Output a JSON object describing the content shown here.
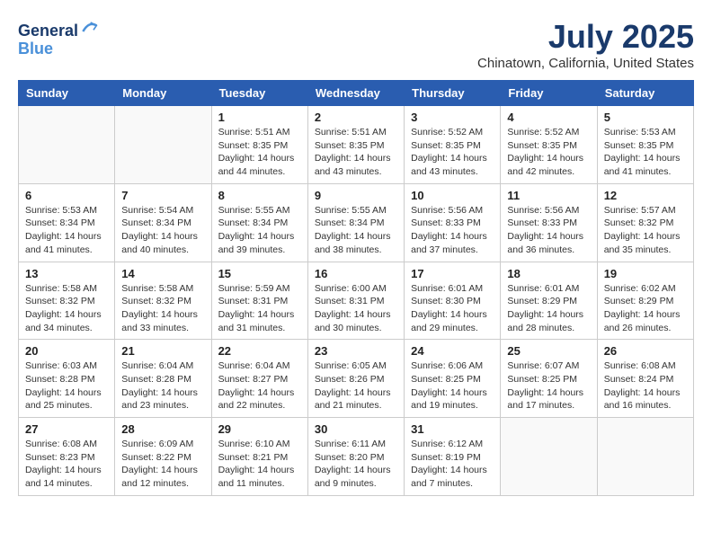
{
  "header": {
    "logo_line1": "General",
    "logo_line2": "Blue",
    "month_title": "July 2025",
    "location": "Chinatown, California, United States"
  },
  "weekdays": [
    "Sunday",
    "Monday",
    "Tuesday",
    "Wednesday",
    "Thursday",
    "Friday",
    "Saturday"
  ],
  "weeks": [
    [
      {
        "day": "",
        "info": ""
      },
      {
        "day": "",
        "info": ""
      },
      {
        "day": "1",
        "info": "Sunrise: 5:51 AM\nSunset: 8:35 PM\nDaylight: 14 hours and 44 minutes."
      },
      {
        "day": "2",
        "info": "Sunrise: 5:51 AM\nSunset: 8:35 PM\nDaylight: 14 hours and 43 minutes."
      },
      {
        "day": "3",
        "info": "Sunrise: 5:52 AM\nSunset: 8:35 PM\nDaylight: 14 hours and 43 minutes."
      },
      {
        "day": "4",
        "info": "Sunrise: 5:52 AM\nSunset: 8:35 PM\nDaylight: 14 hours and 42 minutes."
      },
      {
        "day": "5",
        "info": "Sunrise: 5:53 AM\nSunset: 8:35 PM\nDaylight: 14 hours and 41 minutes."
      }
    ],
    [
      {
        "day": "6",
        "info": "Sunrise: 5:53 AM\nSunset: 8:34 PM\nDaylight: 14 hours and 41 minutes."
      },
      {
        "day": "7",
        "info": "Sunrise: 5:54 AM\nSunset: 8:34 PM\nDaylight: 14 hours and 40 minutes."
      },
      {
        "day": "8",
        "info": "Sunrise: 5:55 AM\nSunset: 8:34 PM\nDaylight: 14 hours and 39 minutes."
      },
      {
        "day": "9",
        "info": "Sunrise: 5:55 AM\nSunset: 8:34 PM\nDaylight: 14 hours and 38 minutes."
      },
      {
        "day": "10",
        "info": "Sunrise: 5:56 AM\nSunset: 8:33 PM\nDaylight: 14 hours and 37 minutes."
      },
      {
        "day": "11",
        "info": "Sunrise: 5:56 AM\nSunset: 8:33 PM\nDaylight: 14 hours and 36 minutes."
      },
      {
        "day": "12",
        "info": "Sunrise: 5:57 AM\nSunset: 8:32 PM\nDaylight: 14 hours and 35 minutes."
      }
    ],
    [
      {
        "day": "13",
        "info": "Sunrise: 5:58 AM\nSunset: 8:32 PM\nDaylight: 14 hours and 34 minutes."
      },
      {
        "day": "14",
        "info": "Sunrise: 5:58 AM\nSunset: 8:32 PM\nDaylight: 14 hours and 33 minutes."
      },
      {
        "day": "15",
        "info": "Sunrise: 5:59 AM\nSunset: 8:31 PM\nDaylight: 14 hours and 31 minutes."
      },
      {
        "day": "16",
        "info": "Sunrise: 6:00 AM\nSunset: 8:31 PM\nDaylight: 14 hours and 30 minutes."
      },
      {
        "day": "17",
        "info": "Sunrise: 6:01 AM\nSunset: 8:30 PM\nDaylight: 14 hours and 29 minutes."
      },
      {
        "day": "18",
        "info": "Sunrise: 6:01 AM\nSunset: 8:29 PM\nDaylight: 14 hours and 28 minutes."
      },
      {
        "day": "19",
        "info": "Sunrise: 6:02 AM\nSunset: 8:29 PM\nDaylight: 14 hours and 26 minutes."
      }
    ],
    [
      {
        "day": "20",
        "info": "Sunrise: 6:03 AM\nSunset: 8:28 PM\nDaylight: 14 hours and 25 minutes."
      },
      {
        "day": "21",
        "info": "Sunrise: 6:04 AM\nSunset: 8:28 PM\nDaylight: 14 hours and 23 minutes."
      },
      {
        "day": "22",
        "info": "Sunrise: 6:04 AM\nSunset: 8:27 PM\nDaylight: 14 hours and 22 minutes."
      },
      {
        "day": "23",
        "info": "Sunrise: 6:05 AM\nSunset: 8:26 PM\nDaylight: 14 hours and 21 minutes."
      },
      {
        "day": "24",
        "info": "Sunrise: 6:06 AM\nSunset: 8:25 PM\nDaylight: 14 hours and 19 minutes."
      },
      {
        "day": "25",
        "info": "Sunrise: 6:07 AM\nSunset: 8:25 PM\nDaylight: 14 hours and 17 minutes."
      },
      {
        "day": "26",
        "info": "Sunrise: 6:08 AM\nSunset: 8:24 PM\nDaylight: 14 hours and 16 minutes."
      }
    ],
    [
      {
        "day": "27",
        "info": "Sunrise: 6:08 AM\nSunset: 8:23 PM\nDaylight: 14 hours and 14 minutes."
      },
      {
        "day": "28",
        "info": "Sunrise: 6:09 AM\nSunset: 8:22 PM\nDaylight: 14 hours and 12 minutes."
      },
      {
        "day": "29",
        "info": "Sunrise: 6:10 AM\nSunset: 8:21 PM\nDaylight: 14 hours and 11 minutes."
      },
      {
        "day": "30",
        "info": "Sunrise: 6:11 AM\nSunset: 8:20 PM\nDaylight: 14 hours and 9 minutes."
      },
      {
        "day": "31",
        "info": "Sunrise: 6:12 AM\nSunset: 8:19 PM\nDaylight: 14 hours and 7 minutes."
      },
      {
        "day": "",
        "info": ""
      },
      {
        "day": "",
        "info": ""
      }
    ]
  ]
}
